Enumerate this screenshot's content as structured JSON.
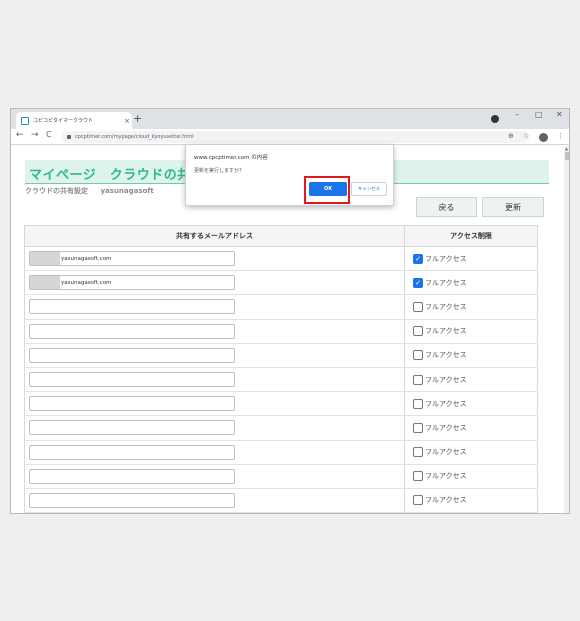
{
  "browser": {
    "tab_title": "コピコピタイマークラウド",
    "tab_close": "×",
    "new_tab": "+",
    "url": "cpcptimer.com/mypage/cloud_kyoyusettei.html",
    "back": "←",
    "forward": "→",
    "reload": "C",
    "zoom": "⊕",
    "bookmark": "☆",
    "menu": "⋮",
    "minimize": "–",
    "maximize": "□",
    "close": "✕"
  },
  "page": {
    "heading": "マイページ　クラウドの共有設定",
    "subtitle": "クラウドの共有設定",
    "username": "yasunagasoft",
    "back_button": "戻る",
    "update_button": "更新",
    "table": {
      "col_email": "共有するメールアドレス",
      "col_access": "アクセス制限",
      "access_label": "フルアクセス",
      "rows": [
        {
          "email": "yasunagasoft.com",
          "masked": true,
          "checked": true
        },
        {
          "email": "yasunagasoft.com",
          "masked": true,
          "checked": true
        },
        {
          "email": "",
          "masked": false,
          "checked": false
        },
        {
          "email": "",
          "masked": false,
          "checked": false
        },
        {
          "email": "",
          "masked": false,
          "checked": false
        },
        {
          "email": "",
          "masked": false,
          "checked": false
        },
        {
          "email": "",
          "masked": false,
          "checked": false
        },
        {
          "email": "",
          "masked": false,
          "checked": false
        },
        {
          "email": "",
          "masked": false,
          "checked": false
        },
        {
          "email": "",
          "masked": false,
          "checked": false
        },
        {
          "email": "",
          "masked": false,
          "checked": false
        }
      ]
    }
  },
  "dialog": {
    "title": "www.cpcptimer.com の内容",
    "message": "更新を実行しますか？",
    "ok": "OK",
    "cancel": "キャンセル"
  },
  "colors": {
    "accent": "#2bb895",
    "heading_band": "#ddf3ec",
    "checkbox": "#1a73e8",
    "highlight": "#e0191e"
  }
}
